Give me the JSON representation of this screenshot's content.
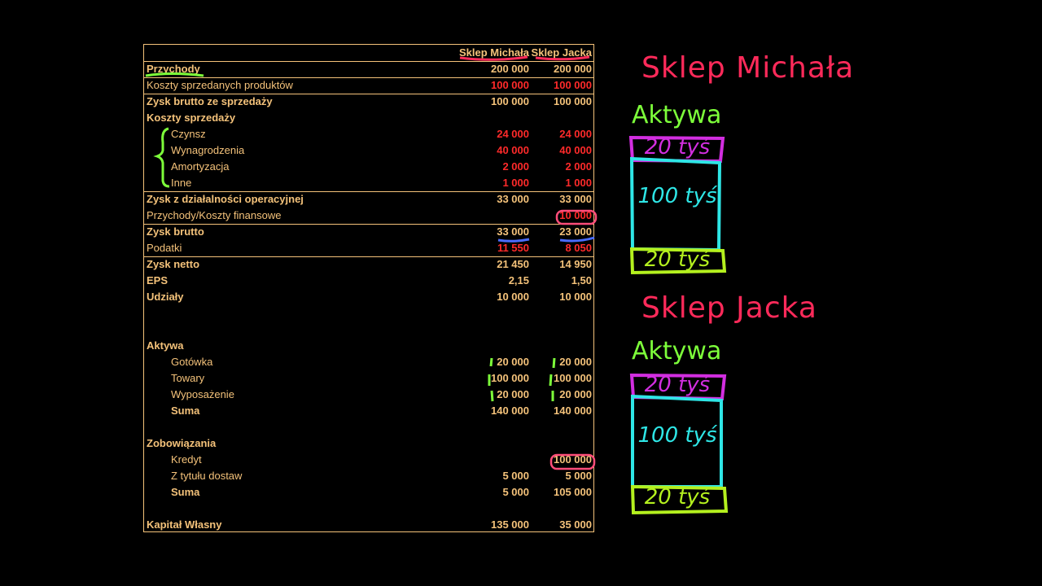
{
  "columns": {
    "col1": "Sklep Michała",
    "col2": "Sklep Jacka"
  },
  "rows": [
    {
      "label": "Przychody",
      "v1": "200 000",
      "v2": "200 000",
      "bold": true,
      "sep": true
    },
    {
      "label": "Koszty sprzedanych produktów",
      "v1": "100 000",
      "v2": "100 000",
      "red": true,
      "sep": true
    },
    {
      "label": "Zysk brutto ze sprzedaży",
      "v1": "100 000",
      "v2": "100 000",
      "bold": true
    },
    {
      "label": "Koszty sprzedaży",
      "v1": "",
      "v2": "",
      "bold": true
    },
    {
      "label": "Czynsz",
      "v1": "24 000",
      "v2": "24 000",
      "indent": true,
      "red": true
    },
    {
      "label": "Wynagrodzenia",
      "v1": "40 000",
      "v2": "40 000",
      "indent": true,
      "red": true
    },
    {
      "label": "Amortyzacja",
      "v1": "2 000",
      "v2": "2 000",
      "indent": true,
      "red": true
    },
    {
      "label": "Inne",
      "v1": "1 000",
      "v2": "1 000",
      "indent": true,
      "red": true,
      "sep": true
    },
    {
      "label": "Zysk z działalności operacyjnej",
      "v1": "33 000",
      "v2": "33 000",
      "bold": true
    },
    {
      "label": "Przychody/Koszty finansowe",
      "v1": "",
      "v2": "10 000",
      "red": true,
      "sep": true
    },
    {
      "label": "Zysk brutto",
      "v1": "33 000",
      "v2": "23 000",
      "bold": true
    },
    {
      "label": "Podatki",
      "v1": "11 550",
      "v2": "8 050",
      "red": true,
      "sep": true
    },
    {
      "label": "Zysk netto",
      "v1": "21 450",
      "v2": "14 950",
      "bold": true
    },
    {
      "label": "EPS",
      "v1": "2,15",
      "v2": "1,50",
      "bold": true
    },
    {
      "label": "Udziały",
      "v1": "10 000",
      "v2": "10 000",
      "bold": true
    },
    {
      "label": "",
      "v1": "",
      "v2": ""
    },
    {
      "label": "",
      "v1": "",
      "v2": ""
    },
    {
      "label": "Aktywa",
      "v1": "",
      "v2": "",
      "bold": true
    },
    {
      "label": "Gotówka",
      "v1": "20 000",
      "v2": "20 000",
      "indent": true
    },
    {
      "label": "Towary",
      "v1": "100 000",
      "v2": "100 000",
      "indent": true
    },
    {
      "label": "Wyposażenie",
      "v1": "20 000",
      "v2": "20 000",
      "indent": true
    },
    {
      "label": "Suma",
      "v1": "140 000",
      "v2": "140 000",
      "indent": true,
      "bold": true
    },
    {
      "label": "",
      "v1": "",
      "v2": ""
    },
    {
      "label": "Zobowiązania",
      "v1": "",
      "v2": "",
      "bold": true
    },
    {
      "label": "Kredyt",
      "v1": "",
      "v2": "100 000",
      "indent": true
    },
    {
      "label": "Z tytułu dostaw",
      "v1": "5 000",
      "v2": "5 000",
      "indent": true
    },
    {
      "label": "Suma",
      "v1": "5 000",
      "v2": "105 000",
      "indent": true,
      "bold": true
    },
    {
      "label": "",
      "v1": "",
      "v2": ""
    },
    {
      "label": "Kapitał Własny",
      "v1": "135 000",
      "v2": "35 000",
      "bold": true
    }
  ],
  "notes": {
    "shop1_title": "Sklep Michała",
    "shop1_assets": "Aktywa",
    "shop1_box_top": "20 tyś",
    "shop1_box_mid": "100 tyś",
    "shop1_box_bot": "20 tyś",
    "shop2_title": "Sklep Jacka",
    "shop2_assets": "Aktywa",
    "shop2_box_top": "20 tyś",
    "shop2_box_mid": "100 tyś",
    "shop2_box_bot": "20 tyś"
  },
  "colors": {
    "table_text": "#f4c27a",
    "negative": "#ff2a2a",
    "title_pen": "#ff2a5a",
    "green_pen": "#7dff3a",
    "magenta_pen": "#d22ee0",
    "cyan_pen": "#2ee6e6",
    "lime_pen": "#b4f01e",
    "blue_pen": "#4a6cff"
  }
}
